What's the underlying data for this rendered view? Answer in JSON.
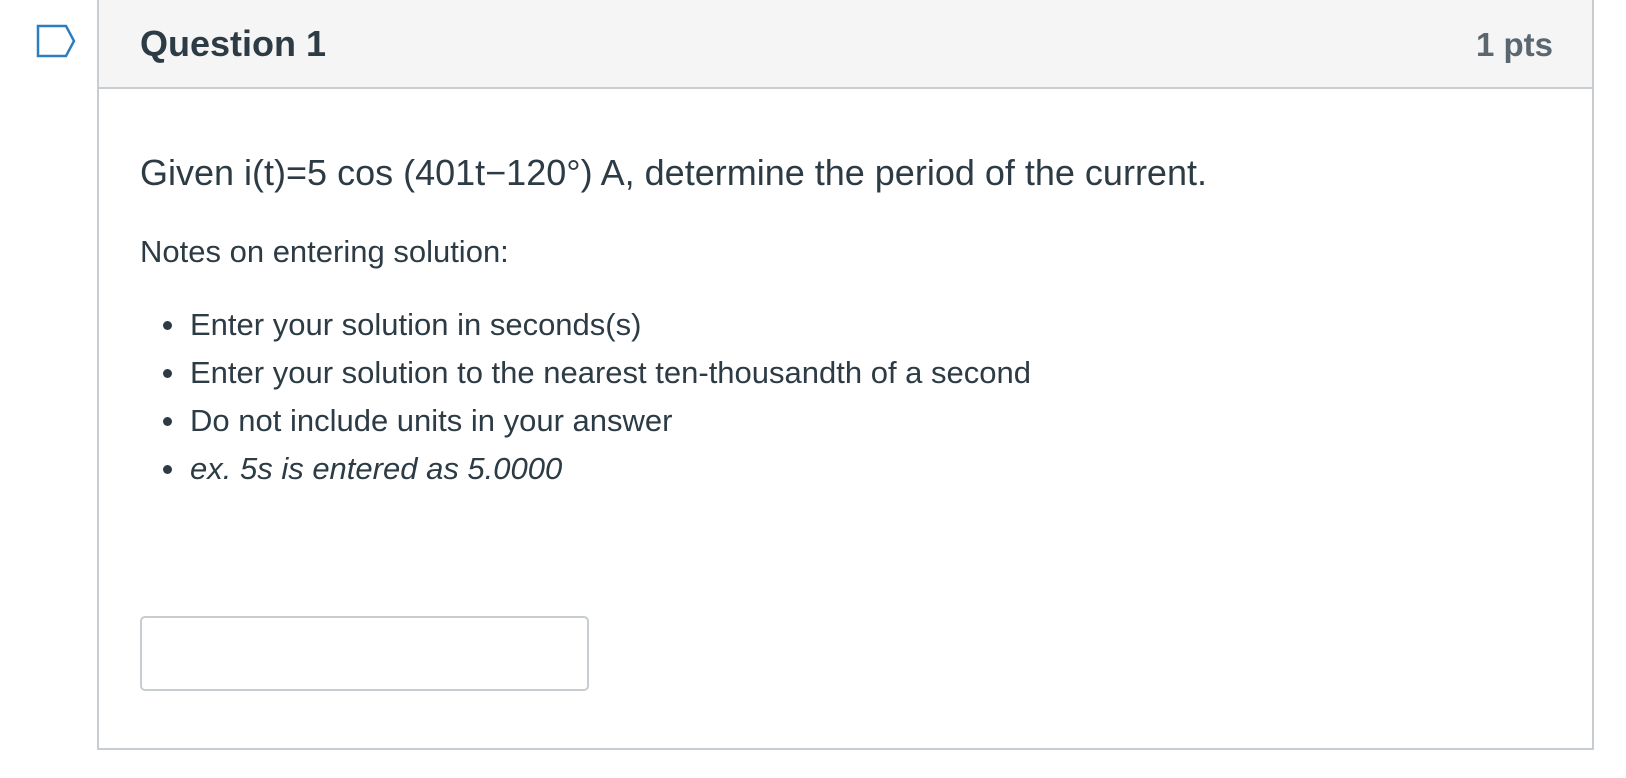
{
  "question": {
    "title": "Question 1",
    "points": "1 pts",
    "text": "Given i(t)=5 cos (401t−120°) A, determine the period of the current.",
    "notes_heading": "Notes on entering solution:",
    "notes": [
      "Enter your solution in seconds(s)",
      "Enter your solution to the nearest ten-thousandth of a second",
      "Do not include units in your answer",
      "ex. 5s is entered as 5.0000"
    ],
    "answer_value": "",
    "flag_icon": "flag-question-icon"
  },
  "colors": {
    "text": "#2d3b45",
    "border": "#c7cdd1",
    "header_bg": "#f5f5f5",
    "flag": "#2d7ebf",
    "points": "#5b6770"
  }
}
